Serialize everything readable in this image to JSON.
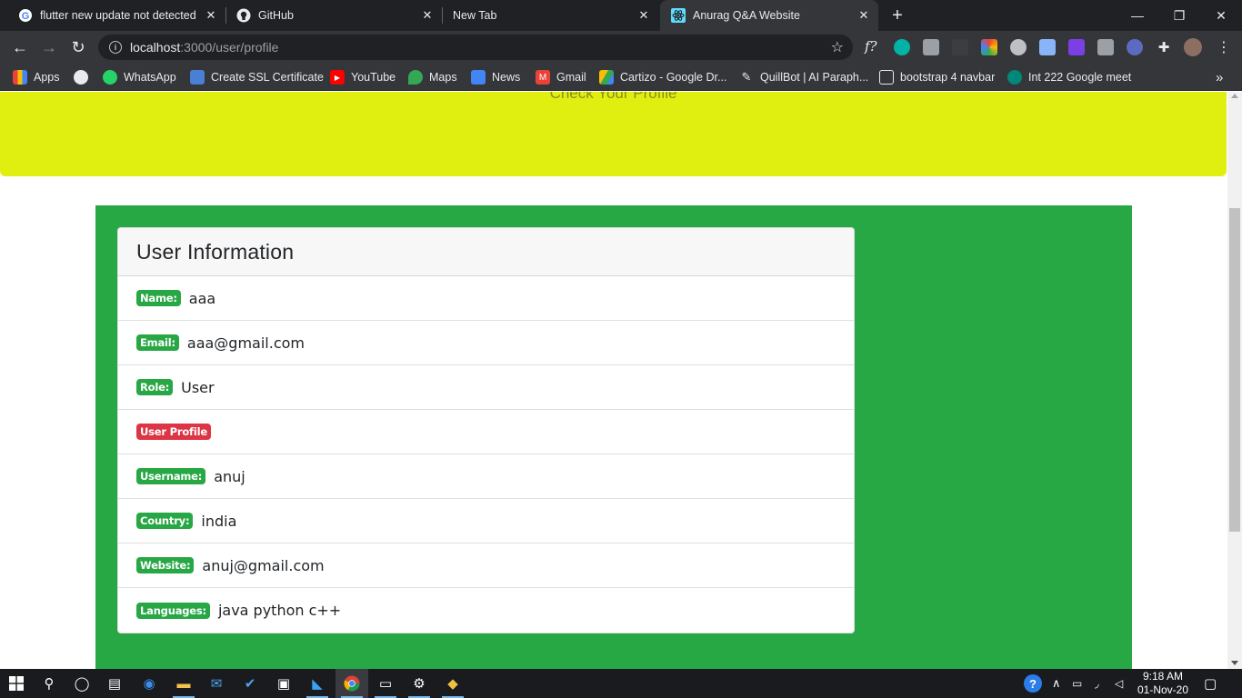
{
  "browser": {
    "tabs": [
      {
        "title": "flutter new update not detected",
        "close": "✕"
      },
      {
        "title": "GitHub",
        "close": "✕"
      },
      {
        "title": "New Tab",
        "close": "✕"
      },
      {
        "title": "Anurag Q&A Website",
        "close": "✕"
      }
    ],
    "new_tab": "+",
    "window": {
      "minimize": "—",
      "restore": "❐",
      "close": "✕"
    },
    "url_host": "localhost",
    "url_path": ":3000/user/profile",
    "ext_text": "f?"
  },
  "bookmarks": [
    {
      "label": "Apps",
      "icon": "apps-grid-icon",
      "color": "#ea4335"
    },
    {
      "label": "",
      "icon": "globe-icon",
      "color": "#e8eaed"
    },
    {
      "label": "WhatsApp",
      "icon": "whatsapp-icon",
      "color": "#25d366"
    },
    {
      "label": "Create SSL Certificate",
      "icon": "puzzle-icon",
      "color": "#4a7fd4"
    },
    {
      "label": "YouTube",
      "icon": "youtube-icon",
      "color": "#ff0000"
    },
    {
      "label": "Maps",
      "icon": "maps-pin-icon",
      "color": "#34a853"
    },
    {
      "label": "News",
      "icon": "news-icon",
      "color": "#4285f4"
    },
    {
      "label": "Gmail",
      "icon": "gmail-icon",
      "color": "#ea4335"
    },
    {
      "label": "Cartizo - Google Dr...",
      "icon": "google-drive-icon",
      "color": "#fbbc04"
    },
    {
      "label": "QuillBot | AI Paraph...",
      "icon": "quill-icon",
      "color": "#e8eaed"
    },
    {
      "label": "bootstrap 4 navbar",
      "icon": "codepen-icon",
      "color": "#e8eaed"
    },
    {
      "label": "Int 222 Google meet",
      "icon": "meet-icon",
      "color": "#00897b"
    }
  ],
  "bookmarks_overflow": "»",
  "page": {
    "hero_text": "Check Your Profile",
    "card_title": "User Information",
    "rows": [
      {
        "label": "Name:",
        "value": "aaa",
        "badge": "green"
      },
      {
        "label": "Email:",
        "value": "aaa@gmail.com",
        "badge": "green"
      },
      {
        "label": "Role:",
        "value": "User",
        "badge": "green"
      },
      {
        "label": "User Profile",
        "value": "",
        "badge": "red"
      },
      {
        "label": "Username:",
        "value": "anuj",
        "badge": "green"
      },
      {
        "label": "Country:",
        "value": "india",
        "badge": "green"
      },
      {
        "label": "Website:",
        "value": "anuj@gmail.com",
        "badge": "green"
      },
      {
        "label": "Languages:",
        "value": "java python c++",
        "badge": "green"
      }
    ]
  },
  "colors": {
    "hero": "#e1ef10",
    "panel": "#28a745",
    "badge_green": "#28a745",
    "badge_red": "#dc3545"
  },
  "taskbar": {
    "time": "9:18 AM",
    "date": "01-Nov-20"
  }
}
